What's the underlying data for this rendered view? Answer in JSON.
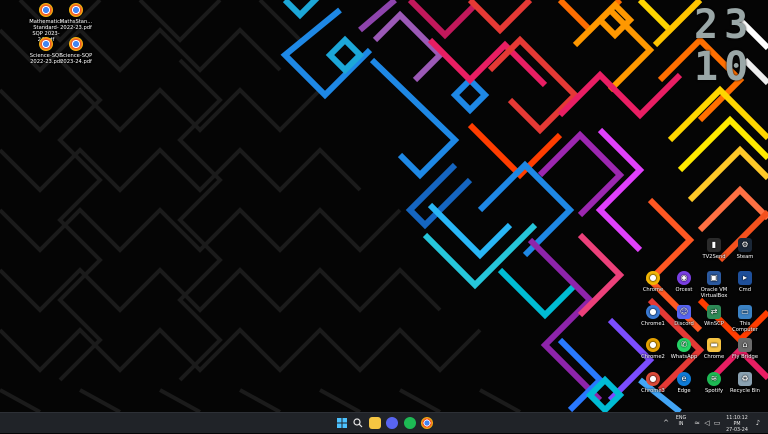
{
  "desktop_icons_left": [
    {
      "label": "Mathematics Standard-SQP 2023-24.pdf",
      "icon": "chrome-icon"
    },
    {
      "label": "MathsStan... 2022-23.pdf",
      "icon": "chrome-icon"
    },
    {
      "label": "Science-SQP 2022-23.pdf",
      "icon": "chrome-icon"
    },
    {
      "label": "Science-SQP 2023-24.pdf",
      "icon": "chrome-icon"
    }
  ],
  "desktop_icons_right": [
    {
      "label": "TV2Send",
      "icon": "chart-icon",
      "color": "#2b2b2b"
    },
    {
      "label": "Steam",
      "icon": "steam-icon",
      "color": "#1b2838"
    },
    {
      "label": "Chrome",
      "icon": "chrome-icon",
      "color": "#f2b705"
    },
    {
      "label": "Orcest",
      "icon": "orb-icon",
      "color": "#7b3fe4"
    },
    {
      "label": "Oracle VM VirtualBox",
      "icon": "virtualbox-icon",
      "color": "#2c5aa0"
    },
    {
      "label": "Cmd",
      "icon": "cmd-icon",
      "color": "#1e4f9a"
    },
    {
      "label": "Chrome1",
      "icon": "chrome-icon",
      "color": "#3a7bd5"
    },
    {
      "label": "Discord",
      "icon": "discord-icon",
      "color": "#5865f2"
    },
    {
      "label": "WinSCP",
      "icon": "winscp-icon",
      "color": "#2e8b57"
    },
    {
      "label": "This Computer",
      "icon": "monitor-icon",
      "color": "#3b82c4"
    },
    {
      "label": "Chrome2",
      "icon": "chrome-icon",
      "color": "#e5a100"
    },
    {
      "label": "WhatsApp",
      "icon": "whatsapp-icon",
      "color": "#25d366"
    },
    {
      "label": "Chrome",
      "icon": "folder-icon",
      "color": "#f6c342"
    },
    {
      "label": "Fly Bridge",
      "icon": "bridge-icon",
      "color": "#6b6b6b"
    },
    {
      "label": "Chrome3",
      "icon": "chrome-icon",
      "color": "#dd4b39"
    },
    {
      "label": "Edge",
      "icon": "edge-icon",
      "color": "#0f7bd6"
    },
    {
      "label": "Spotify",
      "icon": "spotify-icon",
      "color": "#1db954"
    },
    {
      "label": "Recycle Bin",
      "icon": "recycle-bin-icon",
      "color": "#8aa1b1"
    }
  ],
  "clock_widget": {
    "hour": "23",
    "minute": "10"
  },
  "taskbar": {
    "apps": [
      "windows-start-icon",
      "search-icon",
      "file-explorer-icon",
      "discord-icon",
      "spotify-icon",
      "chrome-icon"
    ],
    "language": "ENG",
    "language_sub": "IN",
    "time": "11:10:12 PM",
    "date": "27-03-24"
  }
}
